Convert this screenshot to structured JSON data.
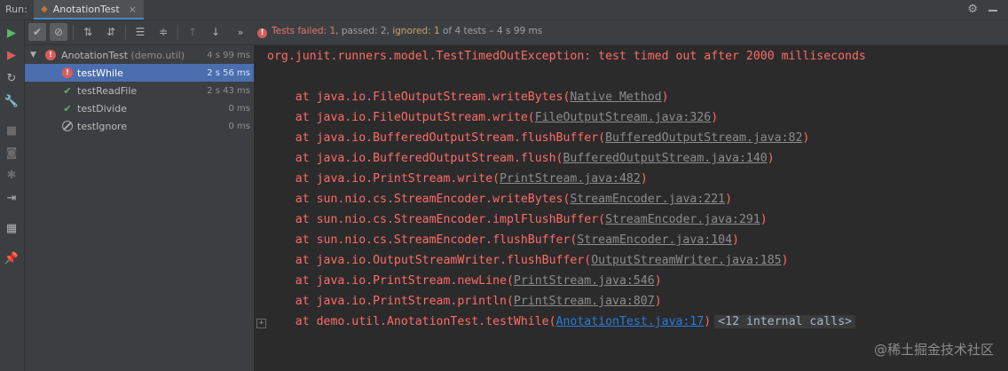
{
  "header": {
    "run_label": "Run:",
    "tab_title": "AnotationTest",
    "tab_close": "×"
  },
  "toolbar": {
    "status_failed_label": "Tests failed: 1",
    "status_passed": ", passed: 2, ",
    "status_ignored": "ignored: 1",
    "status_rest": " of 4 tests – 4 s 99 ms",
    "more": "»"
  },
  "tree": {
    "root": {
      "name": "AnotationTest",
      "pkg": "(demo.util)",
      "time": "4 s 99 ms",
      "status": "failed"
    },
    "items": [
      {
        "name": "testWhile",
        "time": "2 s 56 ms",
        "status": "failed"
      },
      {
        "name": "testReadFile",
        "time": "2 s 43 ms",
        "status": "passed"
      },
      {
        "name": "testDivide",
        "time": "0 ms",
        "status": "passed"
      },
      {
        "name": "testIgnore",
        "time": "0 ms",
        "status": "ignored"
      }
    ]
  },
  "console": {
    "exception": "org.junit.runners.model.TestTimedOutException: test timed out after 2000 milliseconds",
    "frames": [
      {
        "text": "    at java.io.FileOutputStream.writeBytes(",
        "link": "Native Method",
        "end": ")"
      },
      {
        "text": "    at java.io.FileOutputStream.write(",
        "link": "FileOutputStream.java:326",
        "end": ")"
      },
      {
        "text": "    at java.io.BufferedOutputStream.flushBuffer(",
        "link": "BufferedOutputStream.java:82",
        "end": ")"
      },
      {
        "text": "    at java.io.BufferedOutputStream.flush(",
        "link": "BufferedOutputStream.java:140",
        "end": ")"
      },
      {
        "text": "    at java.io.PrintStream.write(",
        "link": "PrintStream.java:482",
        "end": ")"
      },
      {
        "text": "    at sun.nio.cs.StreamEncoder.writeBytes(",
        "link": "StreamEncoder.java:221",
        "end": ")"
      },
      {
        "text": "    at sun.nio.cs.StreamEncoder.implFlushBuffer(",
        "link": "StreamEncoder.java:291",
        "end": ")"
      },
      {
        "text": "    at sun.nio.cs.StreamEncoder.flushBuffer(",
        "link": "StreamEncoder.java:104",
        "end": ")"
      },
      {
        "text": "    at java.io.OutputStreamWriter.flushBuffer(",
        "link": "OutputStreamWriter.java:185",
        "end": ")"
      },
      {
        "text": "    at java.io.PrintStream.newLine(",
        "link": "PrintStream.java:546",
        "end": ")"
      },
      {
        "text": "    at java.io.PrintStream.println(",
        "link": "PrintStream.java:807",
        "end": ")"
      },
      {
        "text": "    at demo.util.AnotationTest.testWhile(",
        "link": "AnotationTest.java:17",
        "end": ")",
        "internal": "<12 internal calls>"
      }
    ],
    "watermark": "@稀土掘金技术社区"
  },
  "colors": {
    "error": "#ff6b68",
    "link": "#287bde",
    "pass": "#5fb865",
    "selected": "#4b6eaf"
  }
}
